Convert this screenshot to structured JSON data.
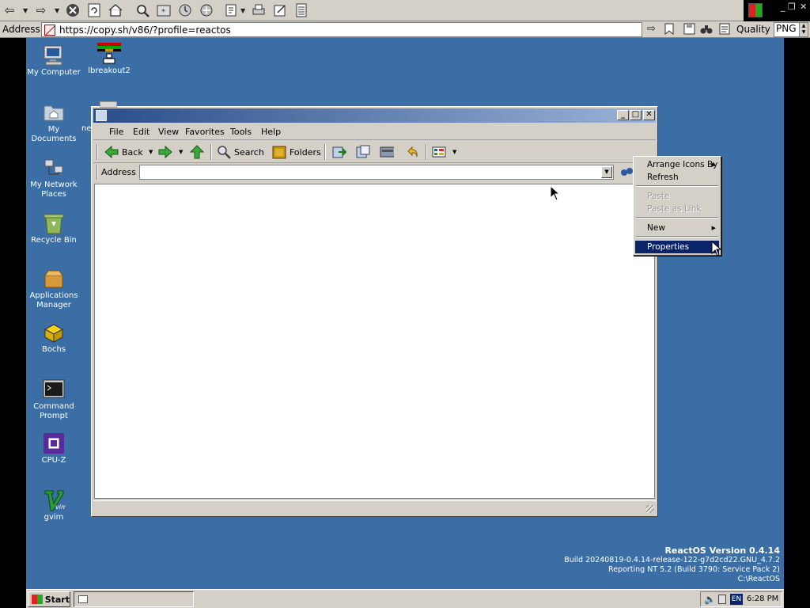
{
  "host": {
    "address_label": "Address",
    "url": "https://copy.sh/v86/?profile=reactos",
    "quality_label": "Quality",
    "format_value": "PNG",
    "toolbar_icons": [
      "back-icon",
      "forward-icon",
      "stop-icon",
      "refresh-icon",
      "home-icon",
      "search-icon",
      "favorites-icon",
      "history-icon",
      "media-icon",
      "edit-icon",
      "print-icon",
      "compose-icon",
      "page-icon"
    ]
  },
  "desktop": {
    "background": "#3a6ea5",
    "icons": [
      {
        "label": "My Computer",
        "icon": "computer-icon"
      },
      {
        "label": "lbreakout2",
        "icon": "game-icon"
      },
      {
        "label": "My Documents",
        "icon": "folder-icon"
      },
      {
        "label": "My Network Places",
        "icon": "network-icon"
      },
      {
        "label": "Recycle Bin",
        "icon": "recycle-bin-icon"
      },
      {
        "label": "Applications Manager",
        "icon": "applications-icon"
      },
      {
        "label": "Bochs",
        "icon": "bochs-icon"
      },
      {
        "label": "Command Prompt",
        "icon": "terminal-icon"
      },
      {
        "label": "CPU-Z",
        "icon": "chip-icon"
      },
      {
        "label": "gvim",
        "icon": "vim-icon"
      }
    ],
    "truncated_label": "ne"
  },
  "explorer": {
    "title": "",
    "menu": [
      "File",
      "Edit",
      "View",
      "Favorites",
      "Tools",
      "Help"
    ],
    "toolbar": {
      "back": "Back",
      "search": "Search",
      "folders": "Folders"
    },
    "address_label": "Address",
    "address_value": ""
  },
  "context_menu": {
    "items": [
      {
        "label": "Arrange Icons By",
        "submenu": true,
        "disabled": false
      },
      {
        "label": "Refresh",
        "submenu": false,
        "disabled": false
      },
      {
        "label": "Paste",
        "submenu": false,
        "disabled": true
      },
      {
        "label": "Paste as Link",
        "submenu": false,
        "disabled": true
      },
      {
        "label": "New",
        "submenu": true,
        "disabled": false
      },
      {
        "label": "Properties",
        "submenu": false,
        "disabled": false,
        "selected": true
      }
    ]
  },
  "version": {
    "title": "ReactOS Version 0.4.14",
    "build": "Build 20240819-0.4.14-release-122-g7d2cd22.GNU_4.7.2",
    "reporting": "Reporting NT 5.2 (Build 3790: Service Pack 2)",
    "path": "C:\\ReactOS"
  },
  "taskbar": {
    "start_label": "Start",
    "language": "EN",
    "time": "6:28 PM"
  }
}
